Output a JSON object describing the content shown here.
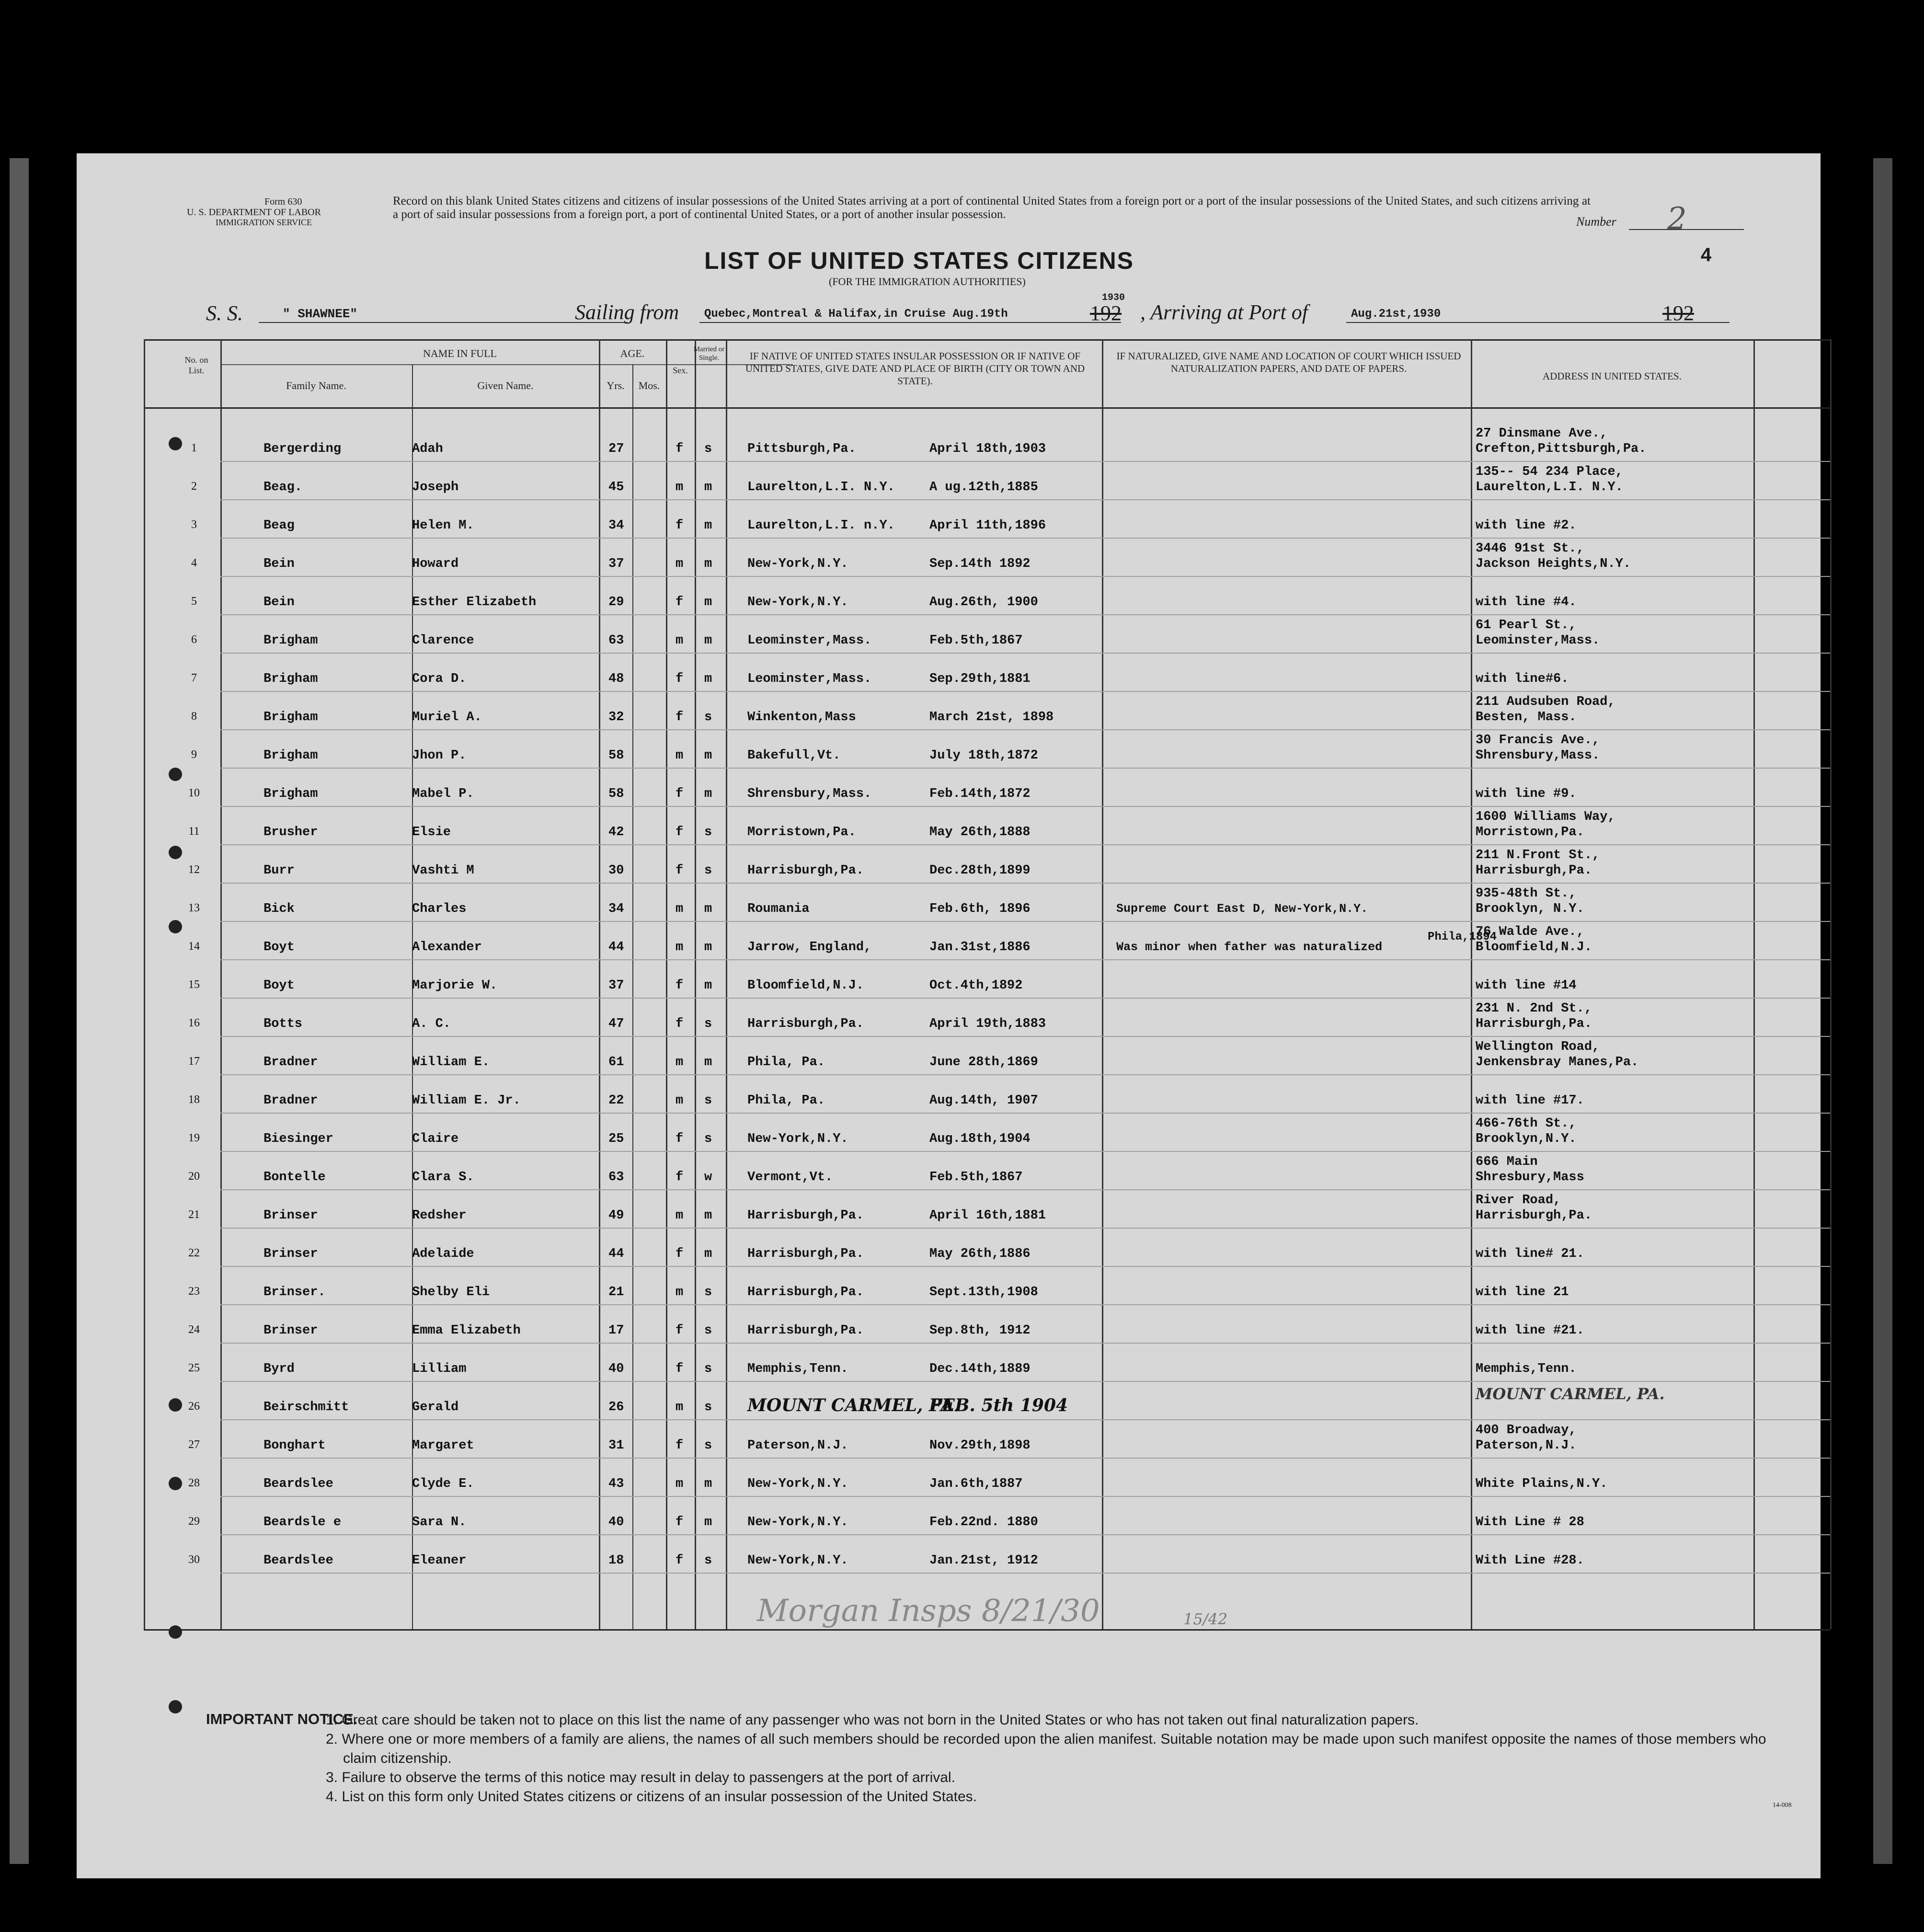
{
  "form": {
    "form_no": "Form 630",
    "dept": "U. S. DEPARTMENT OF LABOR",
    "service": "IMMIGRATION SERVICE",
    "instructions": "Record on this blank United States citizens and citizens of insular possessions of the United States arriving at a port of continental United States from a foreign port or a port of the insular possessions of the United States, and such citizens arriving at a port of said insular possessions from a foreign port, a port of continental United States, or a port of another insular possession.",
    "number_label": "Number",
    "number_value": "2",
    "page_no": "4",
    "title": "LIST OF UNITED STATES CITIZENS",
    "subtitle": "(FOR THE IMMIGRATION AUTHORITIES)",
    "ss_label": "S. S.",
    "ship": "\" SHAWNEE\"",
    "sailing_label": "Sailing from",
    "sailing_from": "Quebec,Montreal & Halifax,in Cruise Aug.19th",
    "year_hand": "1930",
    "year_print": "192",
    "arriving_label": ", Arriving at Port of",
    "arriving": "Aug.21st,1930",
    "year_print2": "192"
  },
  "headers": {
    "no": "No. on List.",
    "name_in_full": "NAME IN FULL",
    "family": "Family Name.",
    "given": "Given Name.",
    "age": "AGE.",
    "yrs": "Yrs.",
    "mos": "Mos.",
    "sex": "Sex.",
    "married": "Married or Single.",
    "birth": "IF NATIVE OF UNITED STATES INSULAR POSSESSION OR IF NATIVE OF UNITED STATES, GIVE DATE AND PLACE OF BIRTH (CITY OR TOWN AND STATE).",
    "naturalized": "IF NATURALIZED, GIVE NAME AND LOCATION OF COURT WHICH ISSUED NATURALIZATION PAPERS, AND DATE OF PAPERS.",
    "address": "ADDRESS IN UNITED STATES."
  },
  "rows": [
    {
      "no": "1",
      "family": "Bergerding",
      "given": "Adah",
      "age": "27",
      "sex": "f",
      "ms": "s",
      "place": "Pittsburgh,Pa.",
      "date": "April 18th,1903",
      "nat": "",
      "addr1": "27 Dinsmane Ave.,",
      "addr2": "Crefton,Pittsburgh,Pa."
    },
    {
      "no": "2",
      "family": "Beag.",
      "given": "Joseph",
      "age": "45",
      "sex": "m",
      "ms": "m",
      "place": "Laurelton,L.I. N.Y.",
      "date": "A ug.12th,1885",
      "nat": "",
      "addr1": "135-- 54 234 Place,",
      "addr2": "Laurelton,L.I. N.Y."
    },
    {
      "no": "3",
      "family": "Beag",
      "given": "Helen M.",
      "age": "34",
      "sex": "f",
      "ms": "m",
      "place": "Laurelton,L.I. n.Y.",
      "date": "April 11th,1896",
      "nat": "",
      "addr1": "",
      "addr2": "with line #2."
    },
    {
      "no": "4",
      "family": "Bein",
      "given": "Howard",
      "age": "37",
      "sex": "m",
      "ms": "m",
      "place": "New-York,N.Y.",
      "date": "Sep.14th 1892",
      "nat": "",
      "addr1": "3446 91st St.,",
      "addr2": "Jackson Heights,N.Y."
    },
    {
      "no": "5",
      "family": "Bein",
      "given": "Esther Elizabeth",
      "age": "29",
      "sex": "f",
      "ms": "m",
      "place": "New-York,N.Y.",
      "date": "Aug.26th, 1900",
      "nat": "",
      "addr1": "",
      "addr2": "with line #4."
    },
    {
      "no": "6",
      "family": "Brigham",
      "given": "Clarence",
      "age": "63",
      "sex": "m",
      "ms": "m",
      "place": "Leominster,Mass.",
      "date": "Feb.5th,1867",
      "nat": "",
      "addr1": "61 Pearl St.,",
      "addr2": "Leominster,Mass."
    },
    {
      "no": "7",
      "family": "Brigham",
      "given": "Cora D.",
      "age": "48",
      "sex": "f",
      "ms": "m",
      "place": "Leominster,Mass.",
      "date": "Sep.29th,1881",
      "nat": "",
      "addr1": "",
      "addr2": "with line#6."
    },
    {
      "no": "8",
      "family": "Brigham",
      "given": "Muriel A.",
      "age": "32",
      "sex": "f",
      "ms": "s",
      "place": "Winkenton,Mass",
      "date": "March 21st, 1898",
      "nat": "",
      "addr1": "211 Audsuben Road,",
      "addr2": "Besten, Mass."
    },
    {
      "no": "9",
      "family": "Brigham",
      "given": "Jhon P.",
      "age": "58",
      "sex": "m",
      "ms": "m",
      "place": "Bakefull,Vt.",
      "date": "July 18th,1872",
      "nat": "",
      "addr1": "30 Francis Ave.,",
      "addr2": "Shrensbury,Mass."
    },
    {
      "no": "10",
      "family": "Brigham",
      "given": "Mabel P.",
      "age": "58",
      "sex": "f",
      "ms": "m",
      "place": "Shrensbury,Mass.",
      "date": "Feb.14th,1872",
      "nat": "",
      "addr1": "",
      "addr2": "with line #9."
    },
    {
      "no": "11",
      "family": "Brusher",
      "given": "Elsie",
      "age": "42",
      "sex": "f",
      "ms": "s",
      "place": "Morristown,Pa.",
      "date": "May 26th,1888",
      "nat": "",
      "addr1": "1600 Williams Way,",
      "addr2": "Morristown,Pa."
    },
    {
      "no": "12",
      "family": "Burr",
      "given": "Vashti M",
      "age": "30",
      "sex": "f",
      "ms": "s",
      "place": "Harrisburgh,Pa.",
      "date": "Dec.28th,1899",
      "nat": "",
      "addr1": "211 N.Front St.,",
      "addr2": "Harrisburgh,Pa."
    },
    {
      "no": "13",
      "family": "Bick",
      "given": "Charles",
      "age": "34",
      "sex": "m",
      "ms": "m",
      "place": "Roumania",
      "date": "Feb.6th, 1896",
      "nat": "Supreme Court East D, New-York,N.Y.",
      "addr1": "935-48th St.,",
      "addr2": "Brooklyn, N.Y."
    },
    {
      "no": "14",
      "family": "Boyt",
      "given": "Alexander",
      "age": "44",
      "sex": "m",
      "ms": "m",
      "place": "Jarrow, England,",
      "date": "Jan.31st,1886",
      "nat": "Was minor when father was naturalized",
      "addr1": "76 Walde Ave.,",
      "addr2": "Bloomfield,N.J."
    },
    {
      "no": "15",
      "family": "Boyt",
      "given": "Marjorie W.",
      "age": "37",
      "sex": "f",
      "ms": "m",
      "place": "Bloomfield,N.J.",
      "date": "Oct.4th,1892",
      "nat": "",
      "addr1": "",
      "addr2": "with line #14"
    },
    {
      "no": "16",
      "family": "Botts",
      "given": "A. C.",
      "age": "47",
      "sex": "f",
      "ms": "s",
      "place": "Harrisburgh,Pa.",
      "date": "April 19th,1883",
      "nat": "",
      "addr1": "231 N. 2nd St.,",
      "addr2": "Harrisburgh,Pa."
    },
    {
      "no": "17",
      "family": "Bradner",
      "given": "William E.",
      "age": "61",
      "sex": "m",
      "ms": "m",
      "place": "Phila, Pa.",
      "date": "June 28th,1869",
      "nat": "",
      "addr1": "Wellington Road,",
      "addr2": "Jenkensbray Manes,Pa."
    },
    {
      "no": "18",
      "family": "Bradner",
      "given": "William E. Jr.",
      "age": "22",
      "sex": "m",
      "ms": "s",
      "place": "Phila, Pa.",
      "date": "Aug.14th, 1907",
      "nat": "",
      "addr1": "",
      "addr2": "with line #17."
    },
    {
      "no": "19",
      "family": "Biesinger",
      "given": "Claire",
      "age": "25",
      "sex": "f",
      "ms": "s",
      "place": "New-York,N.Y.",
      "date": "Aug.18th,1904",
      "nat": "",
      "addr1": "466-76th St.,",
      "addr2": "Brooklyn,N.Y."
    },
    {
      "no": "20",
      "family": "Bontelle",
      "given": "Clara S.",
      "age": "63",
      "sex": "f",
      "ms": "w",
      "place": "Vermont,Vt.",
      "date": "Feb.5th,1867",
      "nat": "",
      "addr1": "666 Main",
      "addr2": "Shresbury,Mass"
    },
    {
      "no": "21",
      "family": "Brinser",
      "given": "Redsher",
      "age": "49",
      "sex": "m",
      "ms": "m",
      "place": "Harrisburgh,Pa.",
      "date": "April 16th,1881",
      "nat": "",
      "addr1": "River Road,",
      "addr2": "Harrisburgh,Pa."
    },
    {
      "no": "22",
      "family": "Brinser",
      "given": "Adelaide",
      "age": "44",
      "sex": "f",
      "ms": "m",
      "place": "Harrisburgh,Pa.",
      "date": "May 26th,1886",
      "nat": "",
      "addr1": "",
      "addr2": "with line# 21."
    },
    {
      "no": "23",
      "family": "Brinser.",
      "given": "Shelby Eli",
      "age": "21",
      "sex": "m",
      "ms": "s",
      "place": "Harrisburgh,Pa.",
      "date": "Sept.13th,1908",
      "nat": "",
      "addr1": "",
      "addr2": "with line 21"
    },
    {
      "no": "24",
      "family": "Brinser",
      "given": "Emma Elizabeth",
      "age": "17",
      "sex": "f",
      "ms": "s",
      "place": "Harrisburgh,Pa.",
      "date": "Sep.8th, 1912",
      "nat": "",
      "addr1": "",
      "addr2": "with line #21."
    },
    {
      "no": "25",
      "family": "Byrd",
      "given": "Lilliam",
      "age": "40",
      "sex": "f",
      "ms": "s",
      "place": "Memphis,Tenn.",
      "date": "Dec.14th,1889",
      "nat": "",
      "addr1": "",
      "addr2": "Memphis,Tenn."
    },
    {
      "no": "26",
      "family": "Beirschmitt",
      "given": "Gerald",
      "age": "26",
      "sex": "m",
      "ms": "s",
      "place": "MOUNT CARMEL, PA.",
      "date": "FEB. 5th 1904",
      "nat": "",
      "addr1": "MOUNT CARMEL, PA.",
      "addr2": ""
    },
    {
      "no": "27",
      "family": "Bonghart",
      "given": "Margaret",
      "age": "31",
      "sex": "f",
      "ms": "s",
      "place": "Paterson,N.J.",
      "date": "Nov.29th,1898",
      "nat": "",
      "addr1": "400 Broadway,",
      "addr2": "Paterson,N.J."
    },
    {
      "no": "28",
      "family": "Beardslee",
      "given": "Clyde E.",
      "age": "43",
      "sex": "m",
      "ms": "m",
      "place": "New-York,N.Y.",
      "date": "Jan.6th,1887",
      "nat": "",
      "addr1": "",
      "addr2": "White Plains,N.Y."
    },
    {
      "no": "29",
      "family": "Beardsle e",
      "given": "Sara N.",
      "age": "40",
      "sex": "f",
      "ms": "m",
      "place": "New-York,N.Y.",
      "date": "Feb.22nd. 1880",
      "nat": "",
      "addr1": "",
      "addr2": "With Line # 28"
    },
    {
      "no": "30",
      "family": "Beardslee",
      "given": "Eleaner",
      "age": "18",
      "sex": "f",
      "ms": "s",
      "place": "New-York,N.Y.",
      "date": "Jan.21st, 1912",
      "nat": "",
      "addr1": "",
      "addr2": "With Line #28."
    }
  ],
  "extra": {
    "phila_1894": "Phila,1894",
    "signature_hand": "Morgan Insps 8/21/30",
    "fraction_hand": "15/42"
  },
  "notice": {
    "label": "IMPORTANT NOTICE.",
    "items": [
      "1. Great care should be taken not to place on this list the name of any passenger who was not born in the United States or who has not taken out final naturalization papers.",
      "2. Where one or more members of a family are aliens, the names of all such members should be recorded upon the alien manifest.  Suitable notation may be made upon such manifest opposite the names of those members who claim citizenship.",
      "3. Failure to observe the terms of this notice may result in delay to passengers at the port of arrival.",
      "4. List on this form only United States citizens or citizens of an insular possession of the United States."
    ],
    "footer_code": "14-008"
  }
}
